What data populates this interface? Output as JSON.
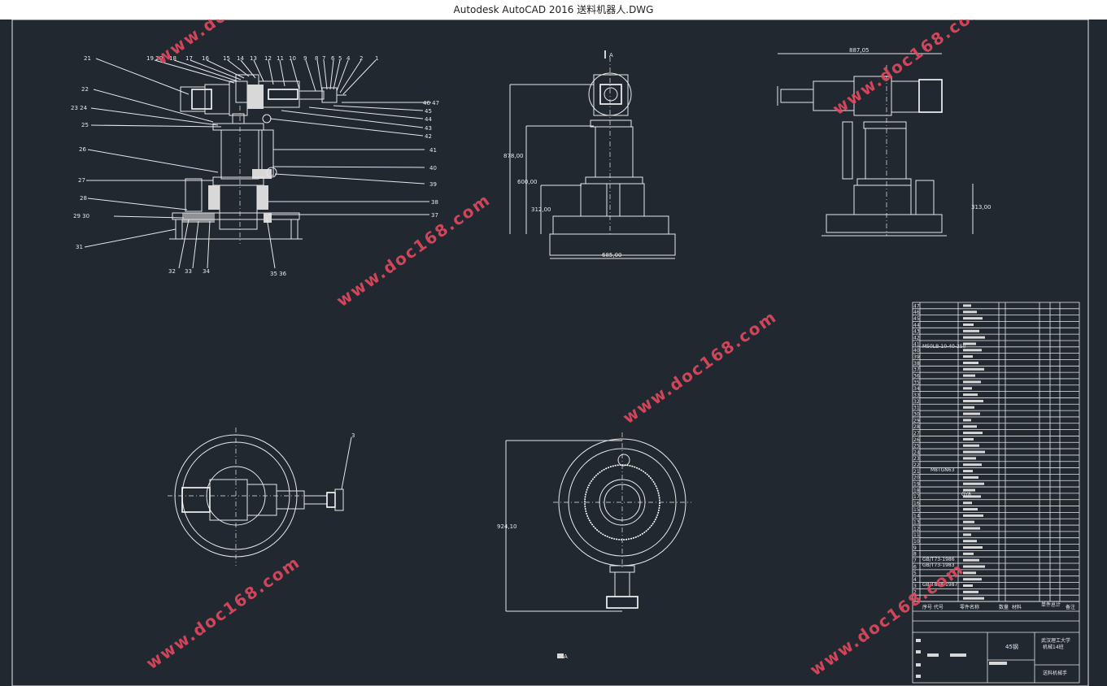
{
  "window": {
    "title": "Autodesk AutoCAD 2016     送料机器人.DWG"
  },
  "watermark": {
    "text": "www.doc168.com",
    "color": "#e5495f"
  },
  "colors": {
    "canvas_bg": "#212830",
    "line": "#e8e8e8",
    "titlebar_bg": "#ffffff"
  },
  "drawing": {
    "part_labels_left_top": [
      "19 20",
      "18",
      "17",
      "16",
      "15",
      "14",
      "13",
      "12",
      "11",
      "10",
      "9",
      "8",
      "7",
      "6",
      "5",
      "4",
      "2",
      "1"
    ],
    "part_labels_left": [
      "21",
      "22",
      "23 24",
      "25",
      "26",
      "27",
      "28",
      "29 30",
      "31"
    ],
    "part_labels_right": [
      "46 47",
      "45",
      "44",
      "43",
      "42",
      "41",
      "40",
      "39",
      "38",
      "37"
    ],
    "part_labels_bottom": [
      "32",
      "33",
      "34",
      "35 36"
    ],
    "part_label_plan": "3",
    "dim_front": [
      "878,00",
      "600,00",
      "312,00",
      "685,00"
    ],
    "view_marker": "A",
    "dim_side": [
      "887,05",
      "313,00"
    ],
    "dim_bottom": "924,10",
    "view_marker_bottom": "A"
  },
  "title_block": {
    "school": "武汉理工大学",
    "class": "机械14班",
    "drawing_name": "送料机械手",
    "material_cell": "45钢",
    "header_cols": [
      "序号",
      "代号",
      "零件名称",
      "数量",
      "材料",
      "单件",
      "总计",
      "备注"
    ],
    "std_parts": [
      "M50LB-10-40-250",
      "M8TGN63",
      "GY8",
      "GB/T73-1986",
      "GB/T73-1983",
      "GB/T828-1987"
    ],
    "row_numbers": [
      "47",
      "46",
      "45",
      "44",
      "43",
      "42",
      "41",
      "40",
      "39",
      "38",
      "37",
      "36",
      "35",
      "34",
      "33",
      "32",
      "31",
      "30",
      "29",
      "28",
      "27",
      "26",
      "25",
      "24",
      "23",
      "22",
      "21",
      "20",
      "19",
      "18",
      "17",
      "16",
      "15",
      "14",
      "13",
      "12",
      "11",
      "10",
      "9",
      "8",
      "7",
      "6",
      "5",
      "4",
      "3",
      "2",
      "1"
    ]
  }
}
